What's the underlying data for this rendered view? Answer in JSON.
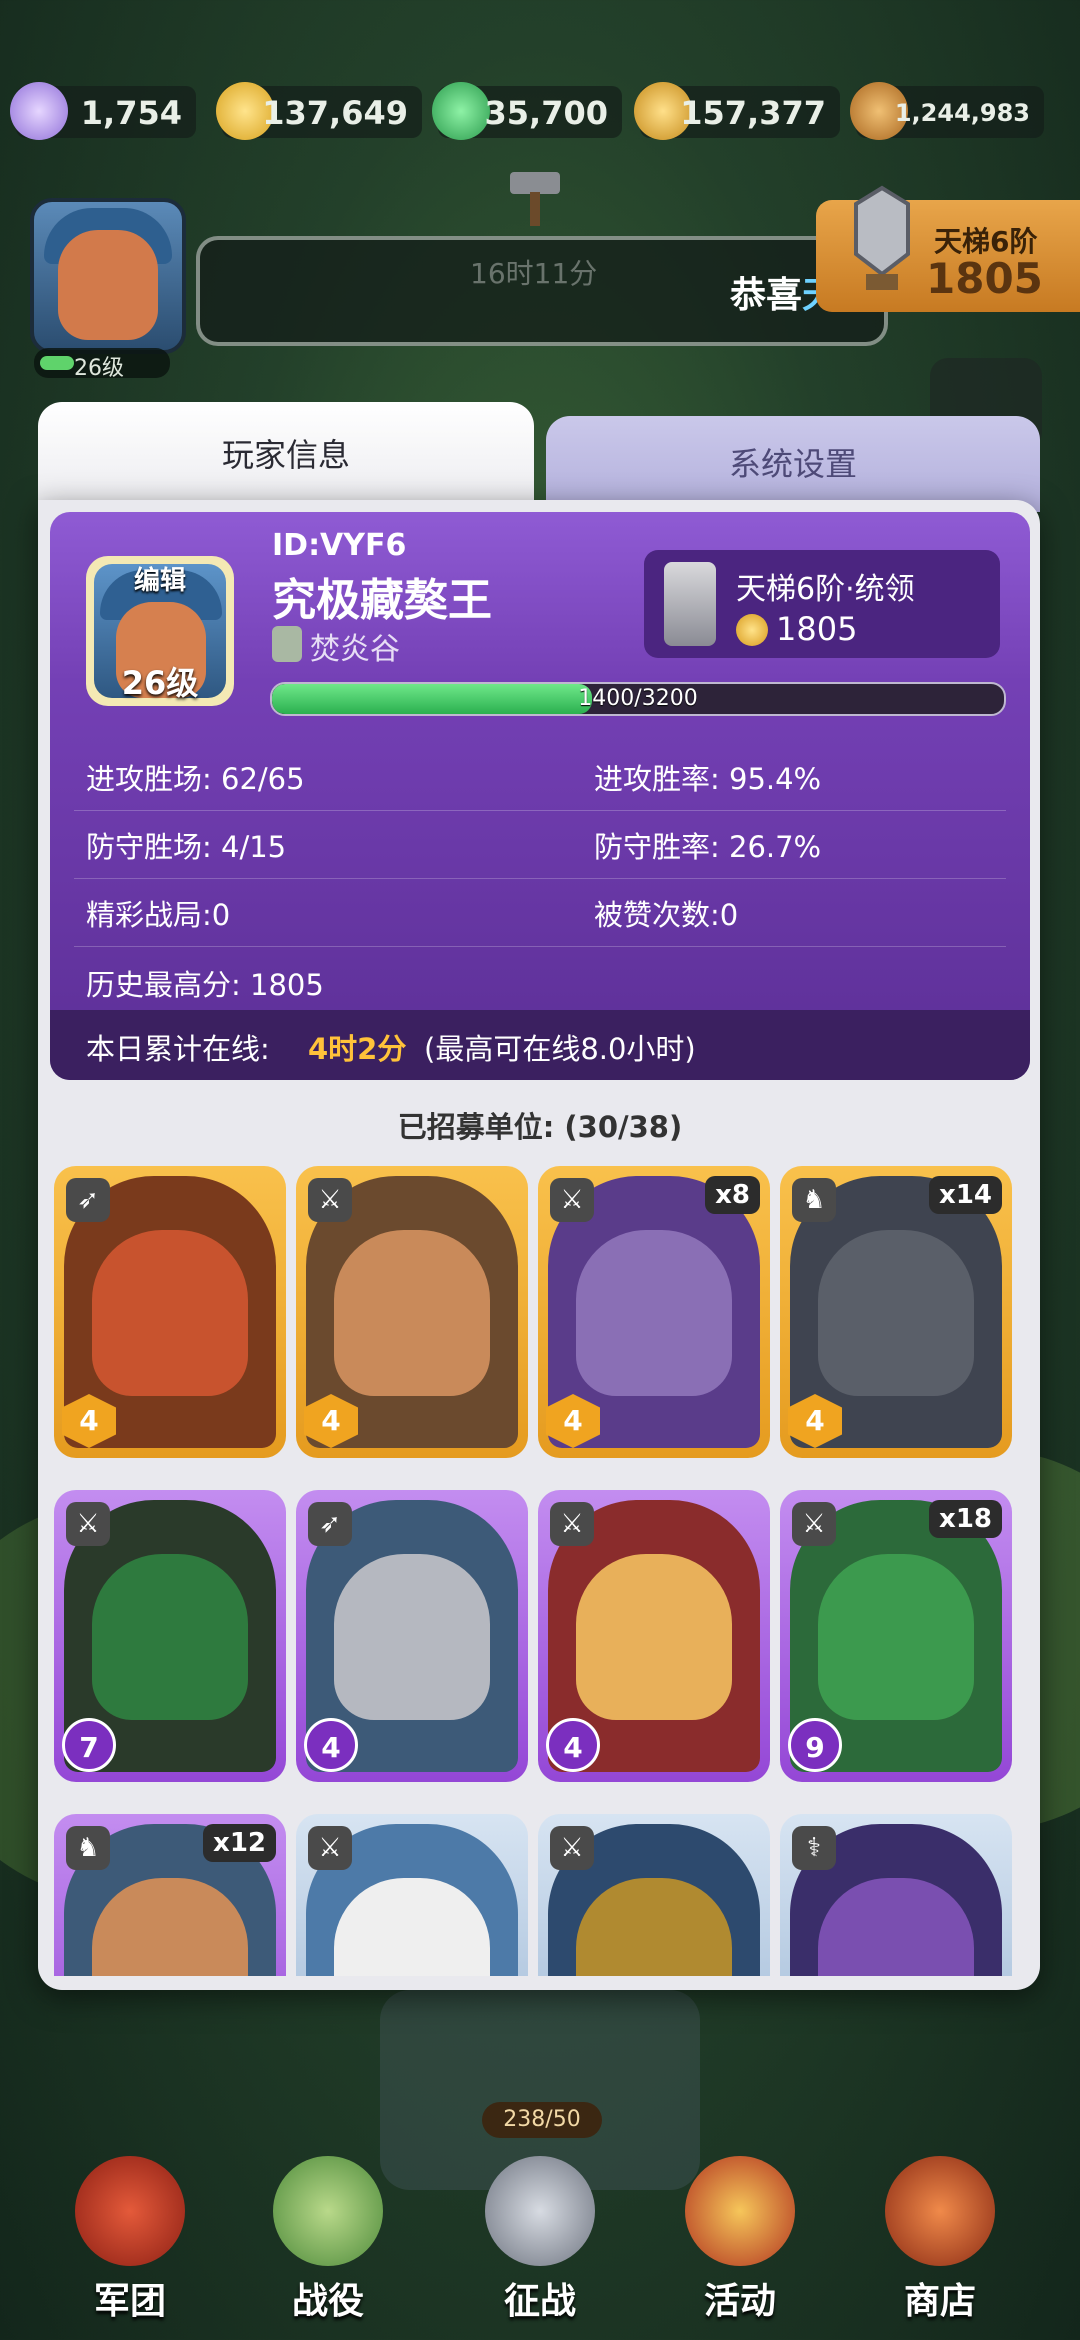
{
  "resources": [
    {
      "icon": "gem-icon",
      "value": "1,754"
    },
    {
      "icon": "gold-coin-icon",
      "value": "137,649"
    },
    {
      "icon": "jade-icon",
      "value": "35,700"
    },
    {
      "icon": "grain-icon",
      "value": "157,377"
    },
    {
      "icon": "wood-icon",
      "value": "1,244,983"
    }
  ],
  "top": {
    "level": "26级",
    "timer": "16时11分",
    "notice_prefix": "恭喜",
    "notice_highlight": "天梯",
    "rank_title": "天梯6阶",
    "rank_score": "1805"
  },
  "tabs": {
    "player_info": "玩家信息",
    "settings": "系统设置"
  },
  "player": {
    "edit_label": "编辑",
    "level": "26级",
    "id": "ID:VYF6",
    "name": "究极藏獒王",
    "guild": "焚炎谷",
    "rank_name": "天梯6阶·统领",
    "rank_score": "1805",
    "xp_text": "1400/3200",
    "xp_fraction": 0.4375
  },
  "stats": [
    {
      "label": "进攻胜场: 62/65",
      "right": "进攻胜率: 95.4%"
    },
    {
      "label": "防守胜场: 4/15",
      "right": "防守胜率: 26.7%"
    },
    {
      "label": "精彩战局:0",
      "right": "被赞次数:0"
    },
    {
      "label": "历史最高分: 1805",
      "right": ""
    }
  ],
  "online": {
    "label": "本日累计在线:",
    "time": "4时2分",
    "limit": "(最高可在线8.0小时)"
  },
  "units_title": "已招募单位: (30/38)",
  "units": [
    {
      "rarity": "gold",
      "type": "bow",
      "star": "4",
      "count": ""
    },
    {
      "rarity": "gold",
      "type": "sword",
      "star": "4",
      "count": ""
    },
    {
      "rarity": "gold",
      "type": "sword",
      "star": "4",
      "count": "x8"
    },
    {
      "rarity": "gold",
      "type": "horse",
      "star": "4",
      "count": "x14"
    },
    {
      "rarity": "purple",
      "type": "sword",
      "star": "7",
      "count": ""
    },
    {
      "rarity": "purple",
      "type": "bow",
      "star": "4",
      "count": ""
    },
    {
      "rarity": "purple",
      "type": "sword",
      "star": "4",
      "count": ""
    },
    {
      "rarity": "purple",
      "type": "sword",
      "star": "9",
      "count": "x18"
    },
    {
      "rarity": "purple",
      "type": "horse",
      "star": "",
      "count": "x12"
    },
    {
      "rarity": "blue",
      "type": "sword",
      "star": "",
      "count": ""
    },
    {
      "rarity": "blue",
      "type": "sword",
      "star": "",
      "count": ""
    },
    {
      "rarity": "blue",
      "type": "staff",
      "star": "",
      "count": ""
    }
  ],
  "nav_badge": "238/50",
  "nav": [
    {
      "icon": "legion-icon",
      "label": "军团"
    },
    {
      "icon": "map-icon",
      "label": "战役"
    },
    {
      "icon": "crossed-swords-icon",
      "label": "征战"
    },
    {
      "icon": "event-icon",
      "label": "活动"
    },
    {
      "icon": "shop-icon",
      "label": "商店"
    }
  ]
}
